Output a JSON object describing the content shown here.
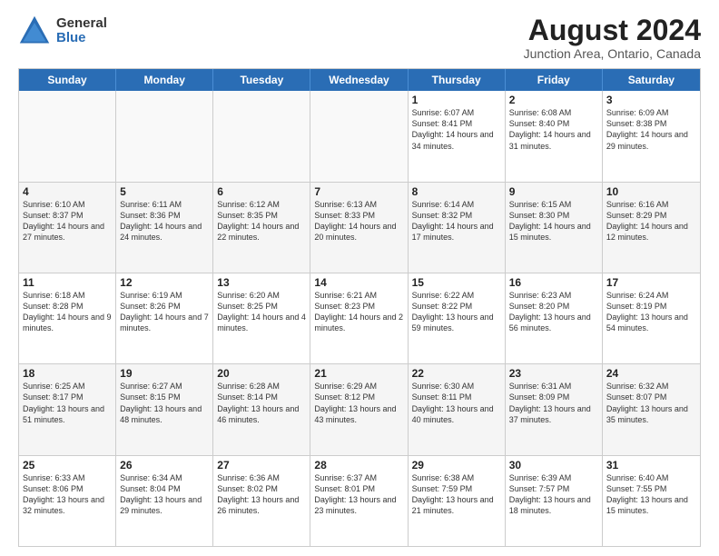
{
  "logo": {
    "general": "General",
    "blue": "Blue"
  },
  "title": "August 2024",
  "location": "Junction Area, Ontario, Canada",
  "weekdays": [
    "Sunday",
    "Monday",
    "Tuesday",
    "Wednesday",
    "Thursday",
    "Friday",
    "Saturday"
  ],
  "rows": [
    [
      {
        "day": "",
        "empty": true,
        "detail": ""
      },
      {
        "day": "",
        "empty": true,
        "detail": ""
      },
      {
        "day": "",
        "empty": true,
        "detail": ""
      },
      {
        "day": "",
        "empty": true,
        "detail": ""
      },
      {
        "day": "1",
        "detail": "Sunrise: 6:07 AM\nSunset: 8:41 PM\nDaylight: 14 hours\nand 34 minutes."
      },
      {
        "day": "2",
        "detail": "Sunrise: 6:08 AM\nSunset: 8:40 PM\nDaylight: 14 hours\nand 31 minutes."
      },
      {
        "day": "3",
        "detail": "Sunrise: 6:09 AM\nSunset: 8:38 PM\nDaylight: 14 hours\nand 29 minutes."
      }
    ],
    [
      {
        "day": "4",
        "detail": "Sunrise: 6:10 AM\nSunset: 8:37 PM\nDaylight: 14 hours\nand 27 minutes."
      },
      {
        "day": "5",
        "detail": "Sunrise: 6:11 AM\nSunset: 8:36 PM\nDaylight: 14 hours\nand 24 minutes."
      },
      {
        "day": "6",
        "detail": "Sunrise: 6:12 AM\nSunset: 8:35 PM\nDaylight: 14 hours\nand 22 minutes."
      },
      {
        "day": "7",
        "detail": "Sunrise: 6:13 AM\nSunset: 8:33 PM\nDaylight: 14 hours\nand 20 minutes."
      },
      {
        "day": "8",
        "detail": "Sunrise: 6:14 AM\nSunset: 8:32 PM\nDaylight: 14 hours\nand 17 minutes."
      },
      {
        "day": "9",
        "detail": "Sunrise: 6:15 AM\nSunset: 8:30 PM\nDaylight: 14 hours\nand 15 minutes."
      },
      {
        "day": "10",
        "detail": "Sunrise: 6:16 AM\nSunset: 8:29 PM\nDaylight: 14 hours\nand 12 minutes."
      }
    ],
    [
      {
        "day": "11",
        "detail": "Sunrise: 6:18 AM\nSunset: 8:28 PM\nDaylight: 14 hours\nand 9 minutes."
      },
      {
        "day": "12",
        "detail": "Sunrise: 6:19 AM\nSunset: 8:26 PM\nDaylight: 14 hours\nand 7 minutes."
      },
      {
        "day": "13",
        "detail": "Sunrise: 6:20 AM\nSunset: 8:25 PM\nDaylight: 14 hours\nand 4 minutes."
      },
      {
        "day": "14",
        "detail": "Sunrise: 6:21 AM\nSunset: 8:23 PM\nDaylight: 14 hours\nand 2 minutes."
      },
      {
        "day": "15",
        "detail": "Sunrise: 6:22 AM\nSunset: 8:22 PM\nDaylight: 13 hours\nand 59 minutes."
      },
      {
        "day": "16",
        "detail": "Sunrise: 6:23 AM\nSunset: 8:20 PM\nDaylight: 13 hours\nand 56 minutes."
      },
      {
        "day": "17",
        "detail": "Sunrise: 6:24 AM\nSunset: 8:19 PM\nDaylight: 13 hours\nand 54 minutes."
      }
    ],
    [
      {
        "day": "18",
        "detail": "Sunrise: 6:25 AM\nSunset: 8:17 PM\nDaylight: 13 hours\nand 51 minutes."
      },
      {
        "day": "19",
        "detail": "Sunrise: 6:27 AM\nSunset: 8:15 PM\nDaylight: 13 hours\nand 48 minutes."
      },
      {
        "day": "20",
        "detail": "Sunrise: 6:28 AM\nSunset: 8:14 PM\nDaylight: 13 hours\nand 46 minutes."
      },
      {
        "day": "21",
        "detail": "Sunrise: 6:29 AM\nSunset: 8:12 PM\nDaylight: 13 hours\nand 43 minutes."
      },
      {
        "day": "22",
        "detail": "Sunrise: 6:30 AM\nSunset: 8:11 PM\nDaylight: 13 hours\nand 40 minutes."
      },
      {
        "day": "23",
        "detail": "Sunrise: 6:31 AM\nSunset: 8:09 PM\nDaylight: 13 hours\nand 37 minutes."
      },
      {
        "day": "24",
        "detail": "Sunrise: 6:32 AM\nSunset: 8:07 PM\nDaylight: 13 hours\nand 35 minutes."
      }
    ],
    [
      {
        "day": "25",
        "detail": "Sunrise: 6:33 AM\nSunset: 8:06 PM\nDaylight: 13 hours\nand 32 minutes."
      },
      {
        "day": "26",
        "detail": "Sunrise: 6:34 AM\nSunset: 8:04 PM\nDaylight: 13 hours\nand 29 minutes."
      },
      {
        "day": "27",
        "detail": "Sunrise: 6:36 AM\nSunset: 8:02 PM\nDaylight: 13 hours\nand 26 minutes."
      },
      {
        "day": "28",
        "detail": "Sunrise: 6:37 AM\nSunset: 8:01 PM\nDaylight: 13 hours\nand 23 minutes."
      },
      {
        "day": "29",
        "detail": "Sunrise: 6:38 AM\nSunset: 7:59 PM\nDaylight: 13 hours\nand 21 minutes."
      },
      {
        "day": "30",
        "detail": "Sunrise: 6:39 AM\nSunset: 7:57 PM\nDaylight: 13 hours\nand 18 minutes."
      },
      {
        "day": "31",
        "detail": "Sunrise: 6:40 AM\nSunset: 7:55 PM\nDaylight: 13 hours\nand 15 minutes."
      }
    ]
  ]
}
